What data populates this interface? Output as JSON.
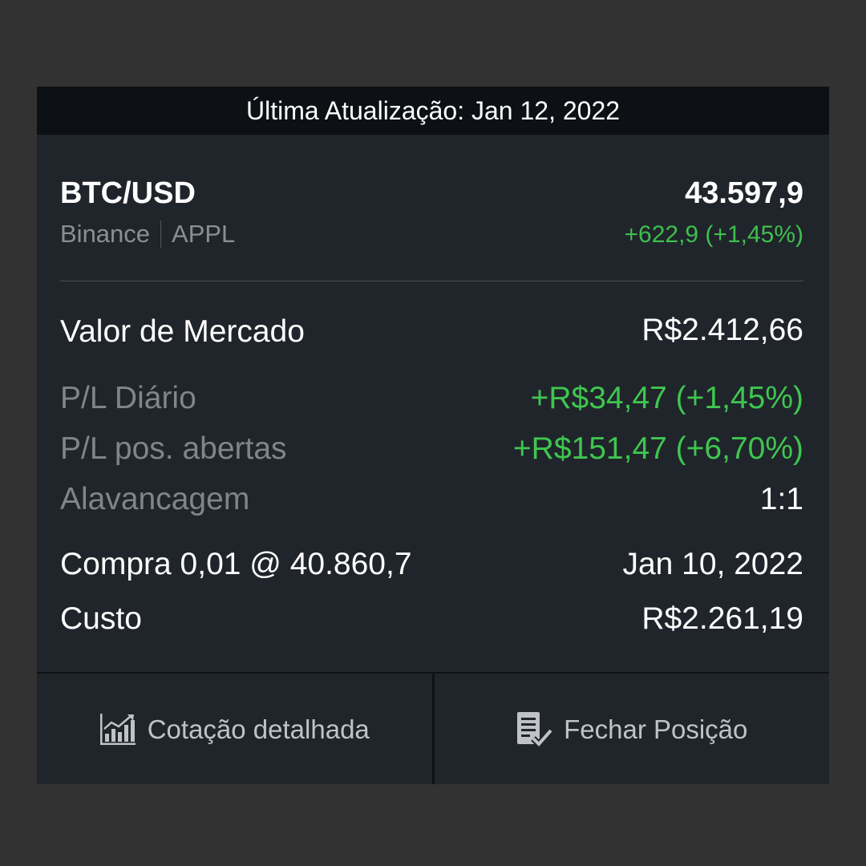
{
  "header": {
    "last_update": "Última Atualização: Jan 12, 2022"
  },
  "instrument": {
    "symbol": "BTC/USD",
    "exchange": "Binance",
    "ticker": "APPL",
    "price": "43.597,9",
    "change": "+622,9 (+1,45%)"
  },
  "details": {
    "market_value_label": "Valor de Mercado",
    "market_value": "R$2.412,66",
    "daily_pl_label": "P/L Diário",
    "daily_pl": "+R$34,47 (+1,45%)",
    "open_pl_label": "P/L pos. abertas",
    "open_pl": "+R$151,47 (+6,70%)",
    "leverage_label": "Alavancagem",
    "leverage": "1:1",
    "buy_label": "Compra 0,01 @ 40.860,7",
    "buy_date": "Jan 10, 2022",
    "cost_label": "Custo",
    "cost": "R$2.261,19"
  },
  "actions": {
    "detailed_quote": "Cotação detalhada",
    "close_position": "Fechar Posição"
  },
  "icons": {
    "detailed_quote_icon": "chart-icon",
    "close_position_icon": "document-check-icon"
  },
  "colors": {
    "positive": "#3fc64f",
    "card_bg": "#20252b",
    "header_bg": "#0d1014"
  }
}
